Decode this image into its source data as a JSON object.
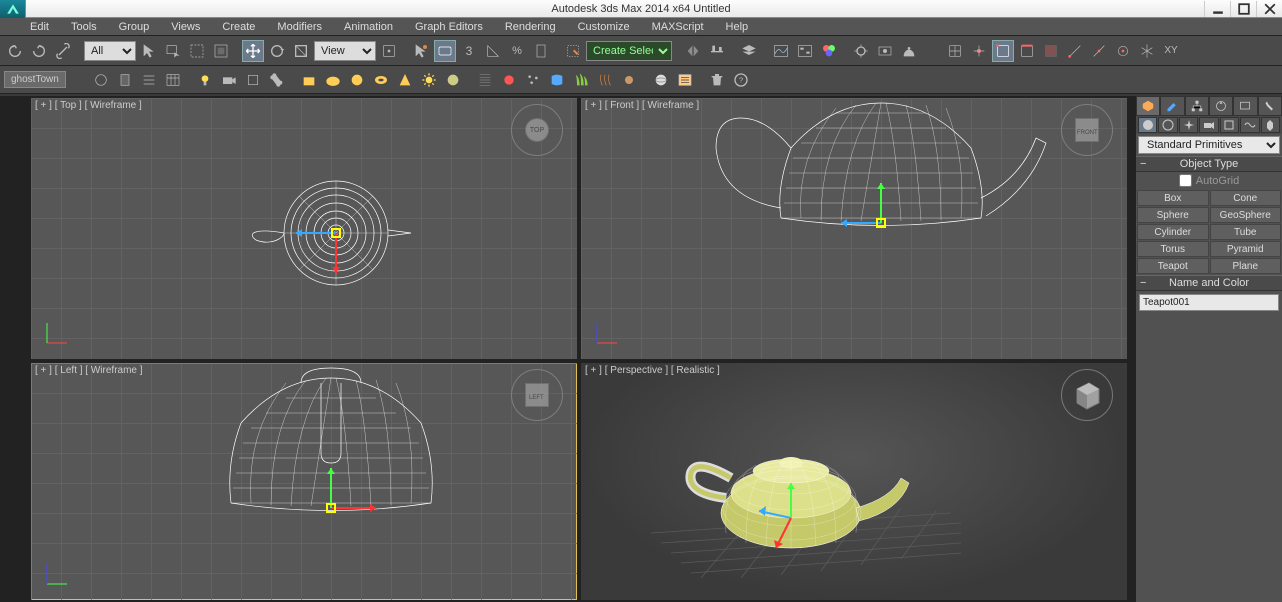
{
  "title_bar": {
    "title": "Autodesk 3ds Max  2014 x64    Untitled"
  },
  "menu": {
    "items": [
      "Edit",
      "Tools",
      "Group",
      "Views",
      "Create",
      "Modifiers",
      "Animation",
      "Graph Editors",
      "Rendering",
      "Customize",
      "MAXScript",
      "Help"
    ]
  },
  "toolbar1": {
    "filter_dropdown": "All",
    "ref_dropdown": "View",
    "snap_value": "3",
    "selection_set": "Create Selection Se"
  },
  "toolbar2": {
    "ghosttown_label": "ghostTown"
  },
  "viewports": {
    "top": "[ + ] [ Top ] [ Wireframe ]",
    "front": "[ + ] [ Front ] [ Wireframe ]",
    "left": "[ + ] [ Left ] [ Wireframe ]",
    "persp": "[ + ] [ Perspective ] [ Realistic ]"
  },
  "viewcube_labels": [
    "TOP",
    "FRONT",
    "LEFT"
  ],
  "command_panel": {
    "category_dropdown": "Standard Primitives",
    "rollout_object_type": "Object Type",
    "autogrid_label": "AutoGrid",
    "buttons": [
      "Box",
      "Cone",
      "Sphere",
      "GeoSphere",
      "Cylinder",
      "Tube",
      "Torus",
      "Pyramid",
      "Teapot",
      "Plane"
    ],
    "rollout_name_color": "Name and Color",
    "object_name": "Teapot001",
    "object_color": "#cccc33"
  }
}
